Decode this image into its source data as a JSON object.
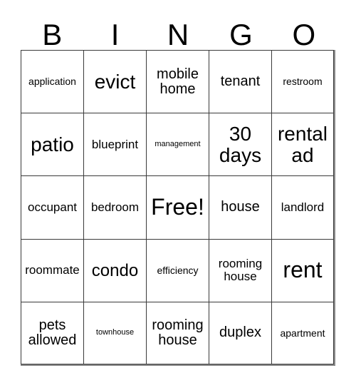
{
  "header": {
    "letters": [
      "B",
      "I",
      "N",
      "G",
      "O"
    ]
  },
  "grid": {
    "rows": 5,
    "columns": 5,
    "cells": [
      {
        "text": "application",
        "size": "sz-s"
      },
      {
        "text": "evict",
        "size": "sz-xl"
      },
      {
        "text": "mobile home",
        "size": "sz-ml"
      },
      {
        "text": "tenant",
        "size": "sz-ml"
      },
      {
        "text": "restroom",
        "size": "sz-s"
      },
      {
        "text": "patio",
        "size": "sz-xl"
      },
      {
        "text": "blueprint",
        "size": "sz-m"
      },
      {
        "text": "management",
        "size": "sz-xs"
      },
      {
        "text": "30 days",
        "size": "sz-xl"
      },
      {
        "text": "rental ad",
        "size": "sz-xl"
      },
      {
        "text": "occupant",
        "size": "sz-m"
      },
      {
        "text": "bedroom",
        "size": "sz-m"
      },
      {
        "text": "Free!",
        "size": "sz-xxl"
      },
      {
        "text": "house",
        "size": "sz-ml"
      },
      {
        "text": "landlord",
        "size": "sz-m"
      },
      {
        "text": "roommate",
        "size": "sz-m"
      },
      {
        "text": "condo",
        "size": "sz-l"
      },
      {
        "text": "efficiency",
        "size": "sz-s"
      },
      {
        "text": "rooming house",
        "size": "sz-m"
      },
      {
        "text": "rent",
        "size": "sz-xxl"
      },
      {
        "text": "pets allowed",
        "size": "sz-ml"
      },
      {
        "text": "townhouse",
        "size": "sz-xs"
      },
      {
        "text": "rooming house",
        "size": "sz-ml"
      },
      {
        "text": "duplex",
        "size": "sz-ml"
      },
      {
        "text": "apartment",
        "size": "sz-s"
      }
    ]
  },
  "colors": {
    "background": "#ffffff",
    "text": "#000000",
    "grid_line": "#3a3a3a",
    "grid_outer_shadow": "#8a8a8a"
  }
}
